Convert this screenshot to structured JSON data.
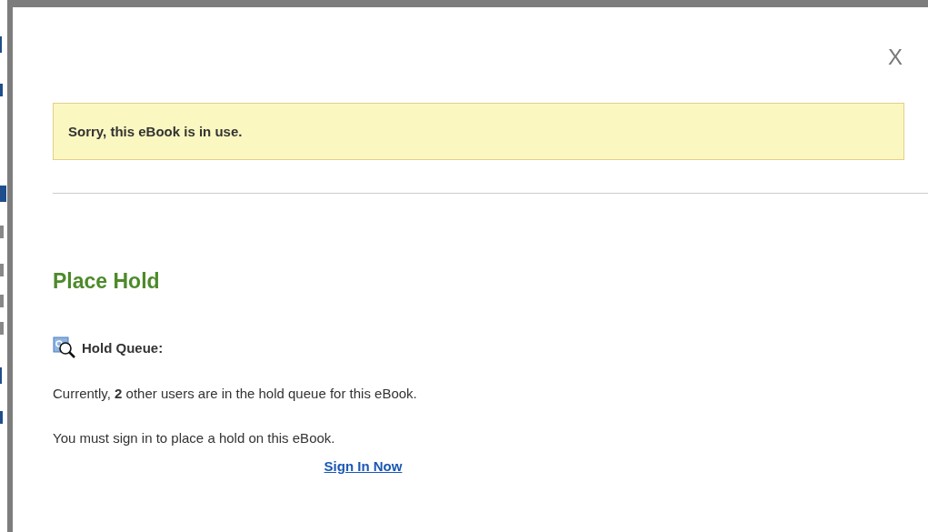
{
  "dialog": {
    "close": "X",
    "alert": "Sorry, this eBook is in use.",
    "title": "Place Hold",
    "queue_label": "Hold Queue:",
    "queue_text": "Currently, **2** other users are in the hold queue for this eBook.",
    "sign_in_text": "You must sign in to place a hold on this eBook.",
    "sign_in_link": "Sign In Now"
  }
}
